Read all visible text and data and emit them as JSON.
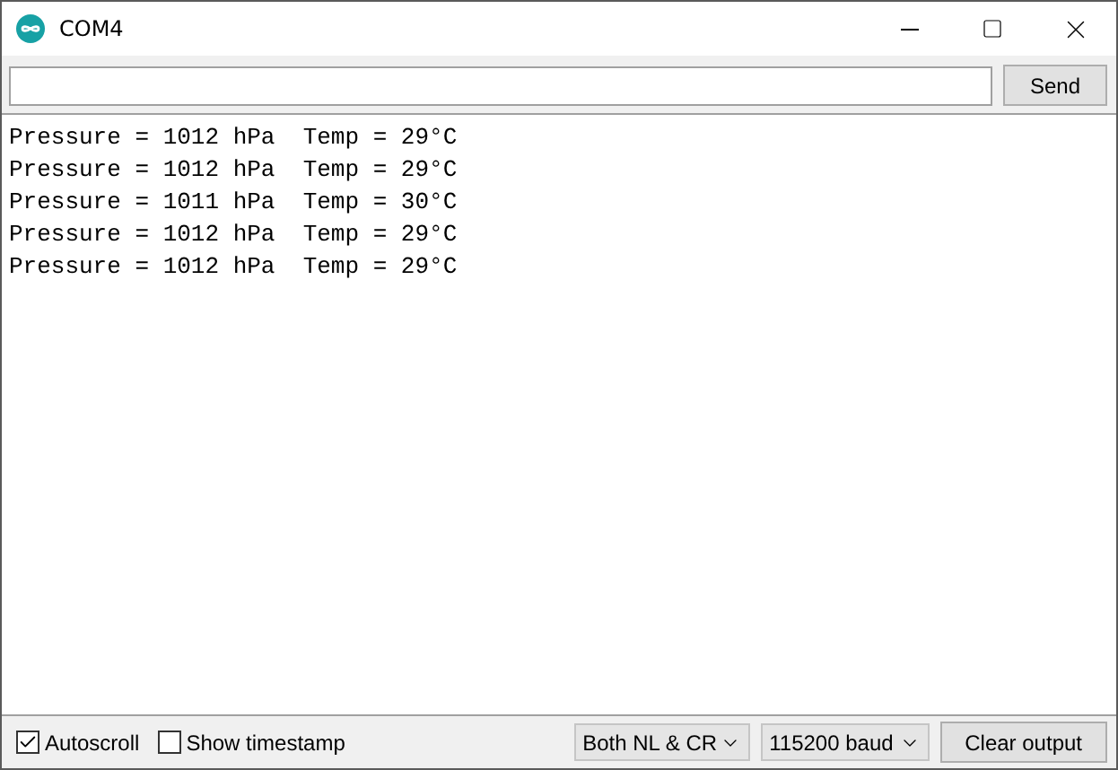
{
  "window": {
    "title": "COM4"
  },
  "send_button": "Send",
  "output_lines": [
    "Pressure = 1012 hPa  Temp = 29°C",
    "Pressure = 1012 hPa  Temp = 29°C",
    "Pressure = 1011 hPa  Temp = 30°C",
    "Pressure = 1012 hPa  Temp = 29°C",
    "Pressure = 1012 hPa  Temp = 29°C"
  ],
  "options": [
    {
      "label": "Autoscroll",
      "checked": true
    },
    {
      "label": "Show timestamp",
      "checked": false
    }
  ],
  "line_ending": "Both NL & CR",
  "baud": "115200 baud",
  "clear_button": "Clear output"
}
